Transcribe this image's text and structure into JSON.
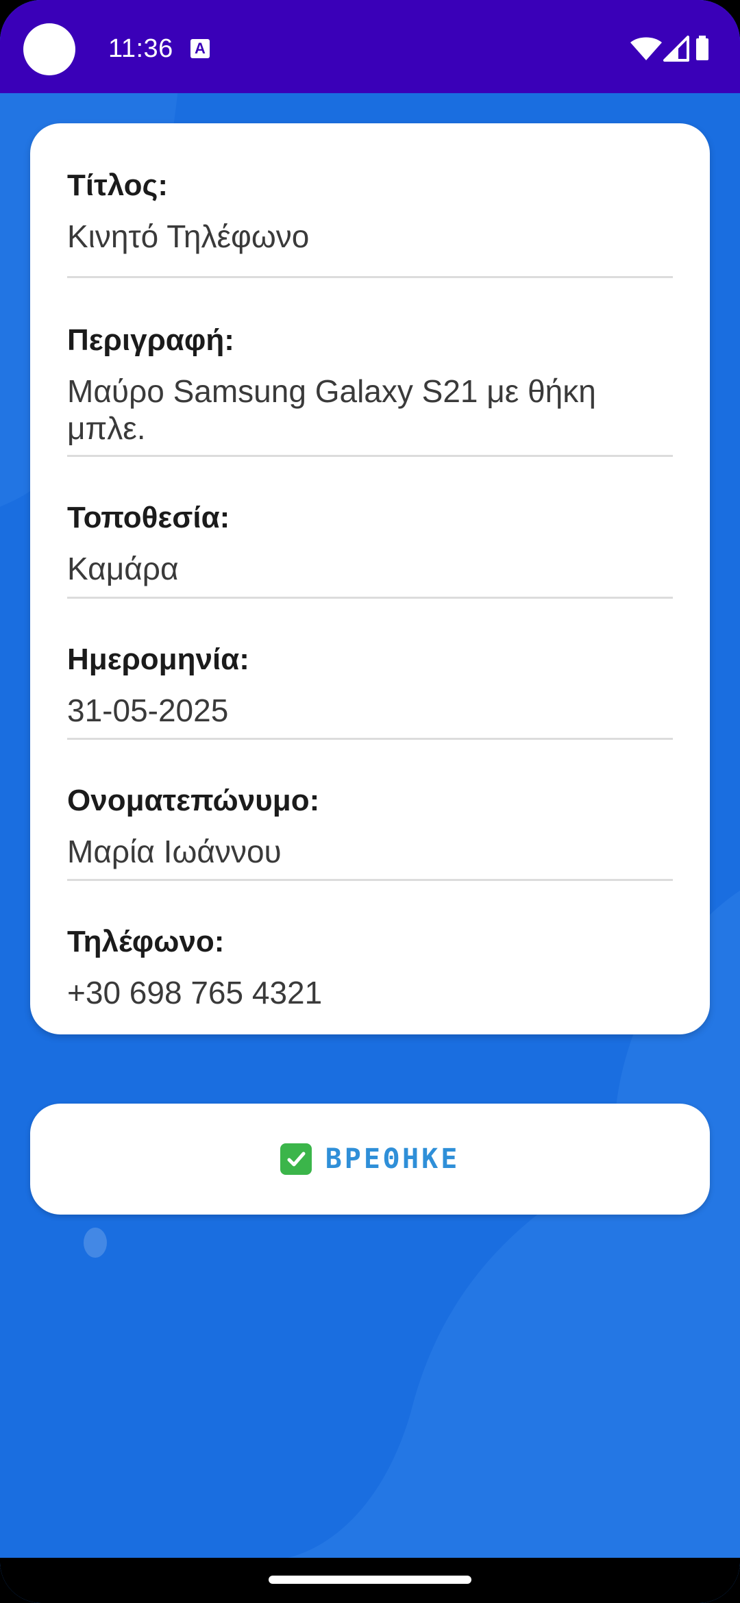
{
  "status_bar": {
    "time": "11:36",
    "notification_icon": "A",
    "icons": [
      "wifi-icon",
      "signal-icon",
      "battery-icon"
    ]
  },
  "details": {
    "title_label": "Τίτλος:",
    "title_value": "Κινητό Τηλέφωνο",
    "description_label": "Περιγραφή:",
    "description_value": "Μαύρο Samsung Galaxy S21 με θήκη μπλε.",
    "location_label": "Τοποθεσία:",
    "location_value": "Καμάρα",
    "date_label": "Ημερομηνία:",
    "date_value": "31-05-2025",
    "name_label": "Ονοματεπώνυμο:",
    "name_value": "Μαρία Ιωάννου",
    "phone_label": "Τηλέφωνο:",
    "phone_value": "+30 698 765 4321"
  },
  "actions": {
    "found_label": "ΒΡΕΘΗΚΕ",
    "found_icon": "check-mark-icon"
  },
  "colors": {
    "status_bar": "#3a00b8",
    "background": "#1a6ee0",
    "button_text": "#2f8fd8",
    "check_green": "#3bb54a"
  }
}
